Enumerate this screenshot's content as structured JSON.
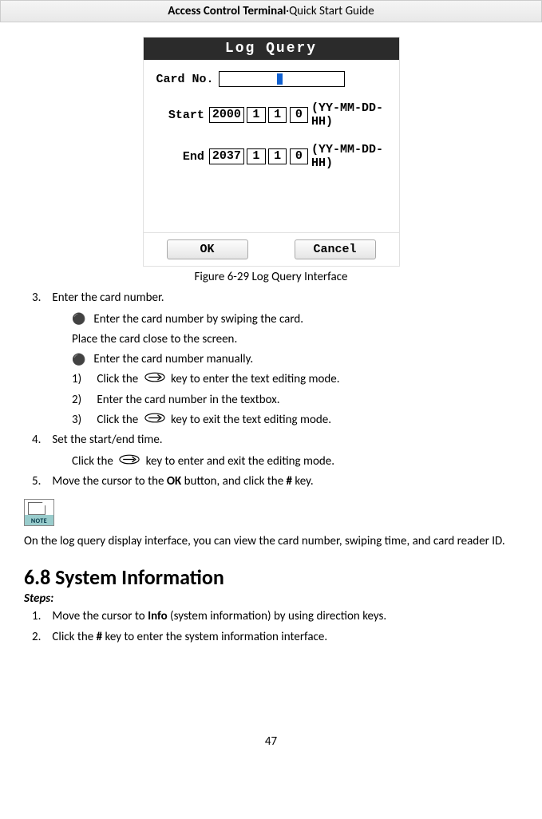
{
  "header": {
    "bold": "Access Control Terminal",
    "dot": "·",
    "rest": "Quick Start Guide"
  },
  "figure": {
    "title": "Log Query",
    "card_label": "Card No.",
    "start_label": "Start",
    "end_label": "End",
    "start": {
      "yy": "2000",
      "mm": "1",
      "dd": "1",
      "hh": "0"
    },
    "end": {
      "yy": "2037",
      "mm": "1",
      "dd": "1",
      "hh": "0"
    },
    "suffix": "(YY-MM-DD-HH)",
    "ok": "OK",
    "cancel": "Cancel",
    "caption_prefix": "Figure 6-29",
    "caption_text": "Log Query Interface"
  },
  "body": {
    "step3": "Enter the card number.",
    "s3_b1": "Enter the card number by swiping the card.",
    "s3_b1_sub": "Place the card close to the screen.",
    "s3_b2": "Enter the card number manually.",
    "s3_1a": "Click the",
    "s3_1b": "key to enter the text editing mode.",
    "s3_2": "Enter the card number in the textbox.",
    "s3_3a": "Click the",
    "s3_3b": "key to exit the text editing mode.",
    "step4": "Set the start/end time.",
    "s4_a": "Click the",
    "s4_b": "key to enter and exit the editing mode.",
    "step5_a": "Move the cursor to the ",
    "step5_ok": "OK",
    "step5_b": " button, and click the ",
    "step5_hash": "#",
    "step5_c": " key.",
    "note_label": "NOTE",
    "note_text": "On the log query display interface, you can view the card number, swiping time, and card reader ID."
  },
  "section": {
    "heading": "6.8 System Information",
    "steps": "Steps:",
    "s1_a": "Move the cursor to ",
    "s1_info": "Info",
    "s1_b": " (system information) by using direction keys.",
    "s2_a": "Click the ",
    "s2_hash": "#",
    "s2_b": " key to enter the system information interface."
  },
  "page_number": "47"
}
